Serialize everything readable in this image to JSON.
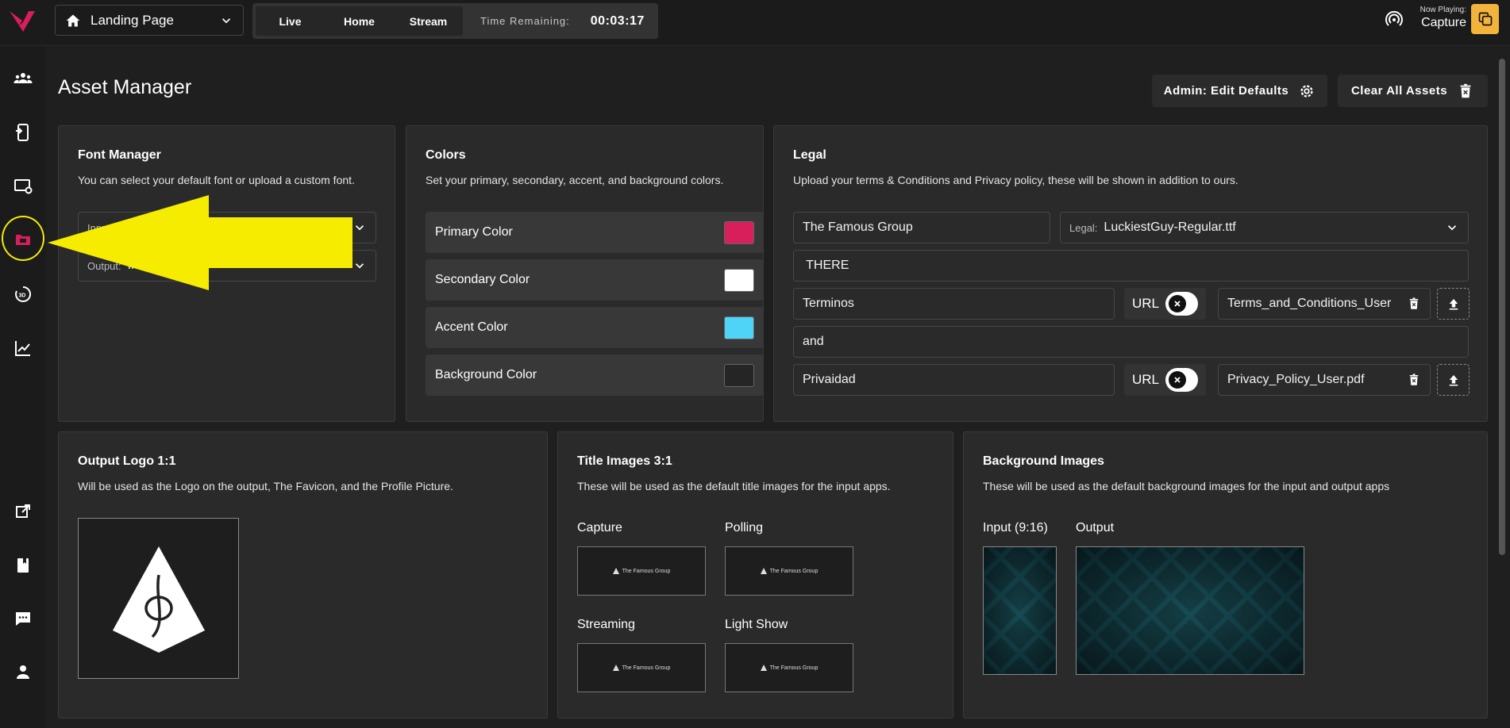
{
  "header": {
    "page_select": "Landing Page",
    "nav_buttons": [
      "Live",
      "Home",
      "Stream"
    ],
    "time_label": "Time Remaining:",
    "time_value": "00:03:17",
    "now_playing_label": "Now Playing:",
    "now_playing_value": "Capture"
  },
  "sidebar": {
    "items": [
      "users-icon",
      "mobile-device-icon",
      "display-settings-icon",
      "asset-folder-icon",
      "rotate-3d-icon",
      "analytics-icon",
      "open-external-icon",
      "book-icon",
      "chat-icon",
      "profile-icon"
    ],
    "active_item": "asset-folder-icon"
  },
  "main": {
    "title": "Asset Manager",
    "admin_button": "Admin: Edit Defaults",
    "clear_button": "Clear All Assets"
  },
  "font_manager": {
    "title": "Font Manager",
    "description": "You can select your default font or upload a custom font.",
    "input_label": "Input:",
    "input_value": "",
    "output_label": "Output:",
    "output_value": "In"
  },
  "colors": {
    "title": "Colors",
    "description": "Set your primary, secondary, accent, and background colors.",
    "rows": [
      {
        "label": "Primary Color",
        "color": "#d81e5b"
      },
      {
        "label": "Secondary Color",
        "color": "#ffffff"
      },
      {
        "label": "Accent Color",
        "color": "#4fd3f7"
      },
      {
        "label": "Background Color",
        "color": "#252525"
      }
    ]
  },
  "legal": {
    "title": "Legal",
    "description": "Upload your terms & Conditions and Privacy policy, these will be shown in addition to ours.",
    "company_name": "The Famous Group",
    "legal_font_label": "Legal:",
    "legal_font_value": "LuckiestGuy-Regular.ttf",
    "intro_text": " THERE",
    "terms_text": "Terminos",
    "terms_url_label": "URL",
    "terms_file": "Terms_and_Conditions_User",
    "joiner_text": "and",
    "privacy_text": "Privaidad",
    "privacy_url_label": "URL",
    "privacy_file": "Privacy_Policy_User.pdf"
  },
  "output_logo": {
    "title": "Output Logo 1:1",
    "description": "Will be used as the Logo on the output, The Favicon, and the Profile Picture."
  },
  "title_images": {
    "title": "Title Images 3:1",
    "description": "These will be used as the default title images for the input apps.",
    "items": [
      {
        "label": "Capture",
        "image_text": "The Famous Group"
      },
      {
        "label": "Polling",
        "image_text": "The Famous Group"
      },
      {
        "label": "Streaming",
        "image_text": "The Famous Group"
      },
      {
        "label": "Light Show",
        "image_text": "The Famous Group"
      }
    ]
  },
  "background_images": {
    "title": "Background Images",
    "description": "These will be used as the default background images for the input and output apps",
    "input_label": "Input (9:16)",
    "output_label": "Output"
  },
  "colors_theme": {
    "accent_yellow": "#f3b43b",
    "brand_pink": "#d81e5b",
    "annotation": "#f5ec00"
  }
}
